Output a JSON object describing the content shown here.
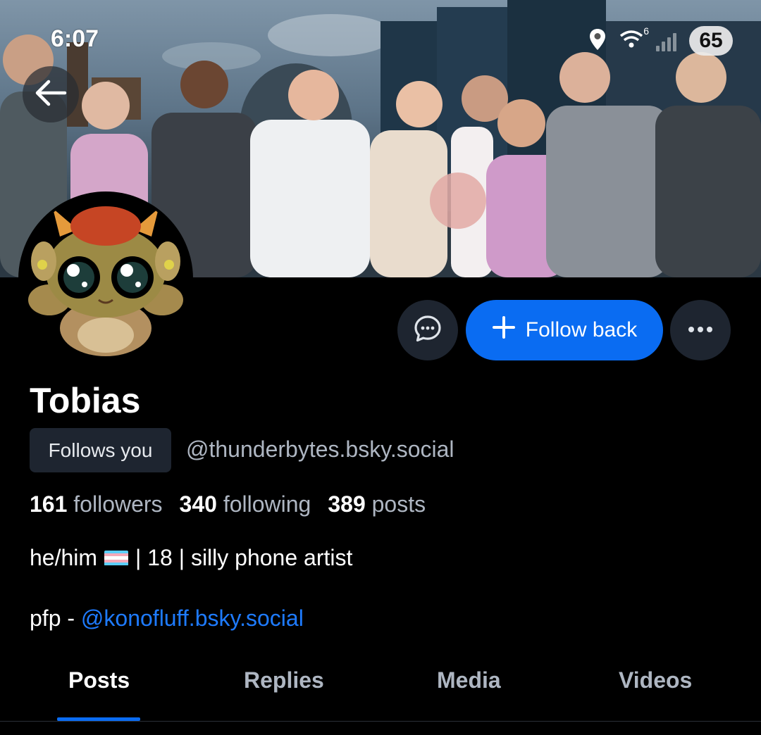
{
  "status_bar": {
    "time": "6:07",
    "battery": "65",
    "network": "6"
  },
  "profile": {
    "display_name": "Tobias",
    "follows_you_label": "Follows you",
    "handle": "@thunderbytes.bsky.social",
    "followers_count": "161",
    "followers_label": "followers",
    "following_count": "340",
    "following_label": "following",
    "posts_count": "389",
    "posts_label": "posts",
    "bio_line1_prefix": "he/him",
    "bio_line1_suffix": "| 18 | silly phone artist",
    "bio_line2_prefix": "pfp - ",
    "bio_line2_link": "@konofluff.bsky.social"
  },
  "actions": {
    "follow_label": "Follow back"
  },
  "tabs": [
    {
      "label": "Posts",
      "active": true
    },
    {
      "label": "Replies",
      "active": false
    },
    {
      "label": "Media",
      "active": false
    },
    {
      "label": "Videos",
      "active": false
    }
  ],
  "colors": {
    "accent": "#0a6cf2",
    "link": "#1e7bff",
    "secondary_text": "#aeb6c2",
    "button_bg": "#1e2530",
    "background": "#000000"
  },
  "icons": [
    "arrow-left-icon",
    "location-icon",
    "wifi-icon",
    "signal-icon",
    "chat-bubble-icon",
    "plus-icon",
    "more-dots-icon",
    "trans-flag-icon"
  ]
}
